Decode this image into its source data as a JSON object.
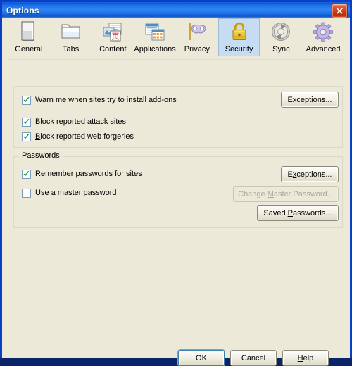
{
  "window": {
    "title": "Options",
    "close_icon": "close-icon",
    "close_label": "Close"
  },
  "tabs": [
    {
      "id": "general",
      "label": "General",
      "icon": "general-icon",
      "selected": false
    },
    {
      "id": "tabs",
      "label": "Tabs",
      "icon": "tabs-folder-icon",
      "selected": false
    },
    {
      "id": "content",
      "label": "Content",
      "icon": "content-icon",
      "selected": false
    },
    {
      "id": "applications",
      "label": "Applications",
      "icon": "applications-icon",
      "selected": false
    },
    {
      "id": "privacy",
      "label": "Privacy",
      "icon": "privacy-mask-icon",
      "selected": false
    },
    {
      "id": "security",
      "label": "Security",
      "icon": "security-lock-icon",
      "selected": true
    },
    {
      "id": "sync",
      "label": "Sync",
      "icon": "sync-arrows-icon",
      "selected": false
    },
    {
      "id": "advanced",
      "label": "Advanced",
      "icon": "advanced-gear-icon",
      "selected": false
    }
  ],
  "security": {
    "warn_addons": {
      "label_pre": "W",
      "label_key": "",
      "label_rest": "arn me when sites try to install add-ons",
      "checked": true
    },
    "block_attack": {
      "label_pre": "Bloc",
      "label_key": "k",
      "label_rest": " reported attack sites",
      "checked": true
    },
    "block_forgeries": {
      "label_pre": "",
      "label_key": "B",
      "label_rest": "lock reported web forgeries",
      "checked": true
    },
    "exceptions_1": "Exceptions..."
  },
  "passwords": {
    "legend": "Passwords",
    "remember": {
      "label_key": "R",
      "label_rest": "emember passwords for sites",
      "checked": true
    },
    "master": {
      "label_key": "U",
      "label_rest": "se a master password",
      "checked": false
    },
    "exceptions_2": "Exceptions...",
    "change_master": "Change Master Password...",
    "change_master_enabled": false,
    "saved_passwords": "Saved Passwords..."
  },
  "footer": {
    "ok": "OK",
    "cancel": "Cancel",
    "help": "Help"
  },
  "colors": {
    "window_background": "#ece9d8",
    "title_blue": "#0a3fc4",
    "selected_tab": "#c5dcf2",
    "check_green": "#1f8a33",
    "close_red": "#cc3b13"
  }
}
